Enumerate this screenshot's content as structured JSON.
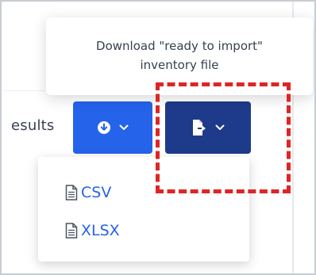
{
  "toolbar": {
    "results_text": "esults",
    "download_button_icon": "download-circle-icon",
    "export_button_icon": "file-export-icon"
  },
  "dropdown": {
    "items": [
      {
        "label": "CSV",
        "icon": "document-icon"
      },
      {
        "label": "XLSX",
        "icon": "document-icon"
      }
    ]
  },
  "tooltip": {
    "line1": "Download \"ready to import\"",
    "line2": "inventory file"
  },
  "colors": {
    "primary_blue": "#2563eb",
    "dark_blue": "#1e3a8a",
    "highlight_red": "#dc2626"
  }
}
